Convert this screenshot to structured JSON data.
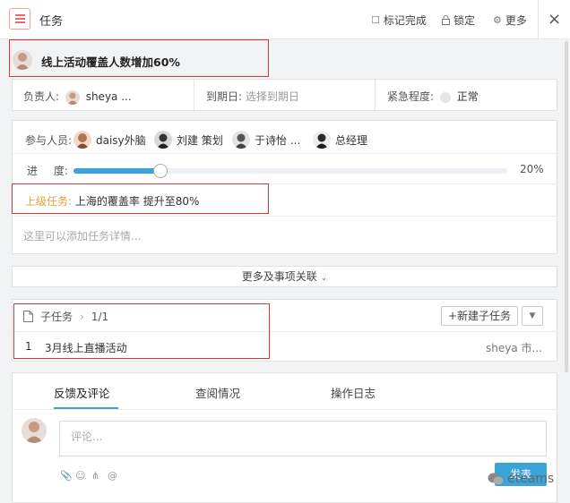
{
  "header": {
    "title": "任务",
    "actions": {
      "mark_done": "标记完成",
      "lock": "锁定",
      "more": "更多"
    },
    "close": "×"
  },
  "task": {
    "title": "线上活动覆盖人数增加60%"
  },
  "meta": {
    "owner_label": "负责人:",
    "owner_value": "sheya ...",
    "due_label": "到期日:",
    "due_placeholder": "选择到期日",
    "urgency_label": "紧急程度:",
    "urgency_value": "正常"
  },
  "participants": {
    "label": "参与人员:",
    "people": [
      {
        "name": "daisy外脑"
      },
      {
        "name": "刘建 策划"
      },
      {
        "name": "于诗怡 ..."
      },
      {
        "name": "总经理"
      }
    ]
  },
  "progress": {
    "label_a": "进",
    "label_b": "度:",
    "value": 0.2,
    "text": "20%"
  },
  "parent_task": {
    "label": "上级任务:",
    "value": "上海的覆盖率 提升至80%"
  },
  "details": {
    "placeholder": "这里可以添加任务详情..."
  },
  "more_link": "更多及事项关联",
  "subtasks": {
    "label": "子任务",
    "count": "1/1",
    "new_button": "+新建子任务",
    "items": [
      {
        "index": "1",
        "title": "3月线上直播活动",
        "owner": "sheya 市..."
      }
    ]
  },
  "tabs": [
    {
      "label": "反馈及评论",
      "active": true
    },
    {
      "label": "查阅情况",
      "active": false
    },
    {
      "label": "操作日志",
      "active": false
    }
  ],
  "comment": {
    "placeholder": "评论...",
    "send": "发表"
  },
  "watermark": "eteams",
  "colors": {
    "accent": "#3aa3d8",
    "highlight_border": "#d9383a"
  }
}
